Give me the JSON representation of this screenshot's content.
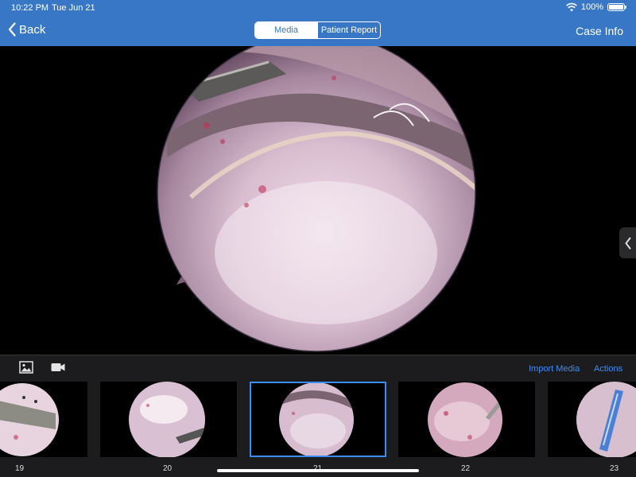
{
  "status_bar": {
    "time": "10:22 PM",
    "date": "Tue Jun 21",
    "battery": "100%"
  },
  "nav": {
    "back_label": "Back",
    "tabs": [
      {
        "label": "Media",
        "active": true
      },
      {
        "label": "Patient Report",
        "active": false
      }
    ],
    "case_info_label": "Case Info"
  },
  "toolbar": {
    "import_label": "Import Media",
    "actions_label": "Actions"
  },
  "thumbnails": [
    {
      "number": "19"
    },
    {
      "number": "20"
    },
    {
      "number": "21",
      "selected": true
    },
    {
      "number": "22"
    },
    {
      "number": "23"
    }
  ],
  "colors": {
    "header": "#3877c6",
    "accent": "#3b8cf5",
    "toolbar": "#1c1c1e"
  }
}
